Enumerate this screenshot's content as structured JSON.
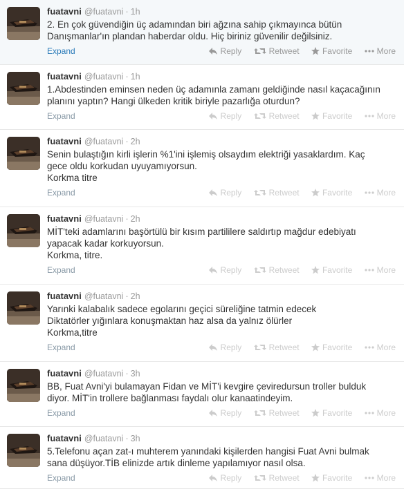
{
  "actions": {
    "expand": "Expand",
    "reply": "Reply",
    "retweet": "Retweet",
    "favorite": "Favorite",
    "more": "More"
  },
  "tweets": [
    {
      "name": "fuatavni",
      "handle": "@fuatavni",
      "time": "1h",
      "lines": [
        "2. En çok güvendiğin üç adamından biri ağzına sahip çıkmayınca bütün",
        "Danışmanlar'ın plandan haberdar oldu. Hiç biriniz güvenilir değilsiniz."
      ]
    },
    {
      "name": "fuatavni",
      "handle": "@fuatavni",
      "time": "1h",
      "lines": [
        "1.Abdestinden eminsen neden üç adamınla zamanı geldiğinde nasıl kaçacağının",
        "planını yaptın? Hangi ülkeden kritik biriyle pazarlığa oturdun?"
      ]
    },
    {
      "name": "fuatavni",
      "handle": "@fuatavni",
      "time": "2h",
      "lines": [
        "Senin bulaştığın kirli işlerin %1'ini işlemiş olsaydım elektriği yasaklardım. Kaç",
        "gece oldu korkudan uyuyamıyorsun.",
        "Korkma titre"
      ]
    },
    {
      "name": "fuatavni",
      "handle": "@fuatavni",
      "time": "2h",
      "lines": [
        "MİT'teki adamlarını başörtülü bir kısım partililere saldırtıp mağdur  edebiyatı",
        "yapacak kadar korkuyorsun.",
        "Korkma, titre."
      ]
    },
    {
      "name": "fuatavni",
      "handle": "@fuatavni",
      "time": "2h",
      "lines": [
        "Yarınki kalabalık sadece egolarını geçici süreliğine tatmin edecek",
        "Diktatörler yığınlara konuşmaktan haz alsa da yalnız ölürler",
        "Korkma,titre"
      ]
    },
    {
      "name": "fuatavni",
      "handle": "@fuatavni",
      "time": "3h",
      "lines": [
        "BB, Fuat Avni'yi bulamayan Fidan ve MİT'i kevgire çeviredursun troller bulduk",
        "diyor. MİT'in trollere bağlanması faydalı olur kanaatindeyim."
      ]
    },
    {
      "name": "fuatavni",
      "handle": "@fuatavni",
      "time": "3h",
      "lines": [
        "5.Telefonu açan zat-ı muhterem yanındaki kişilerden hangisi Fuat Avni bulmak",
        "sana düşüyor.TİB elinizde artık dinleme yapılamıyor nasıl olsa."
      ]
    }
  ]
}
